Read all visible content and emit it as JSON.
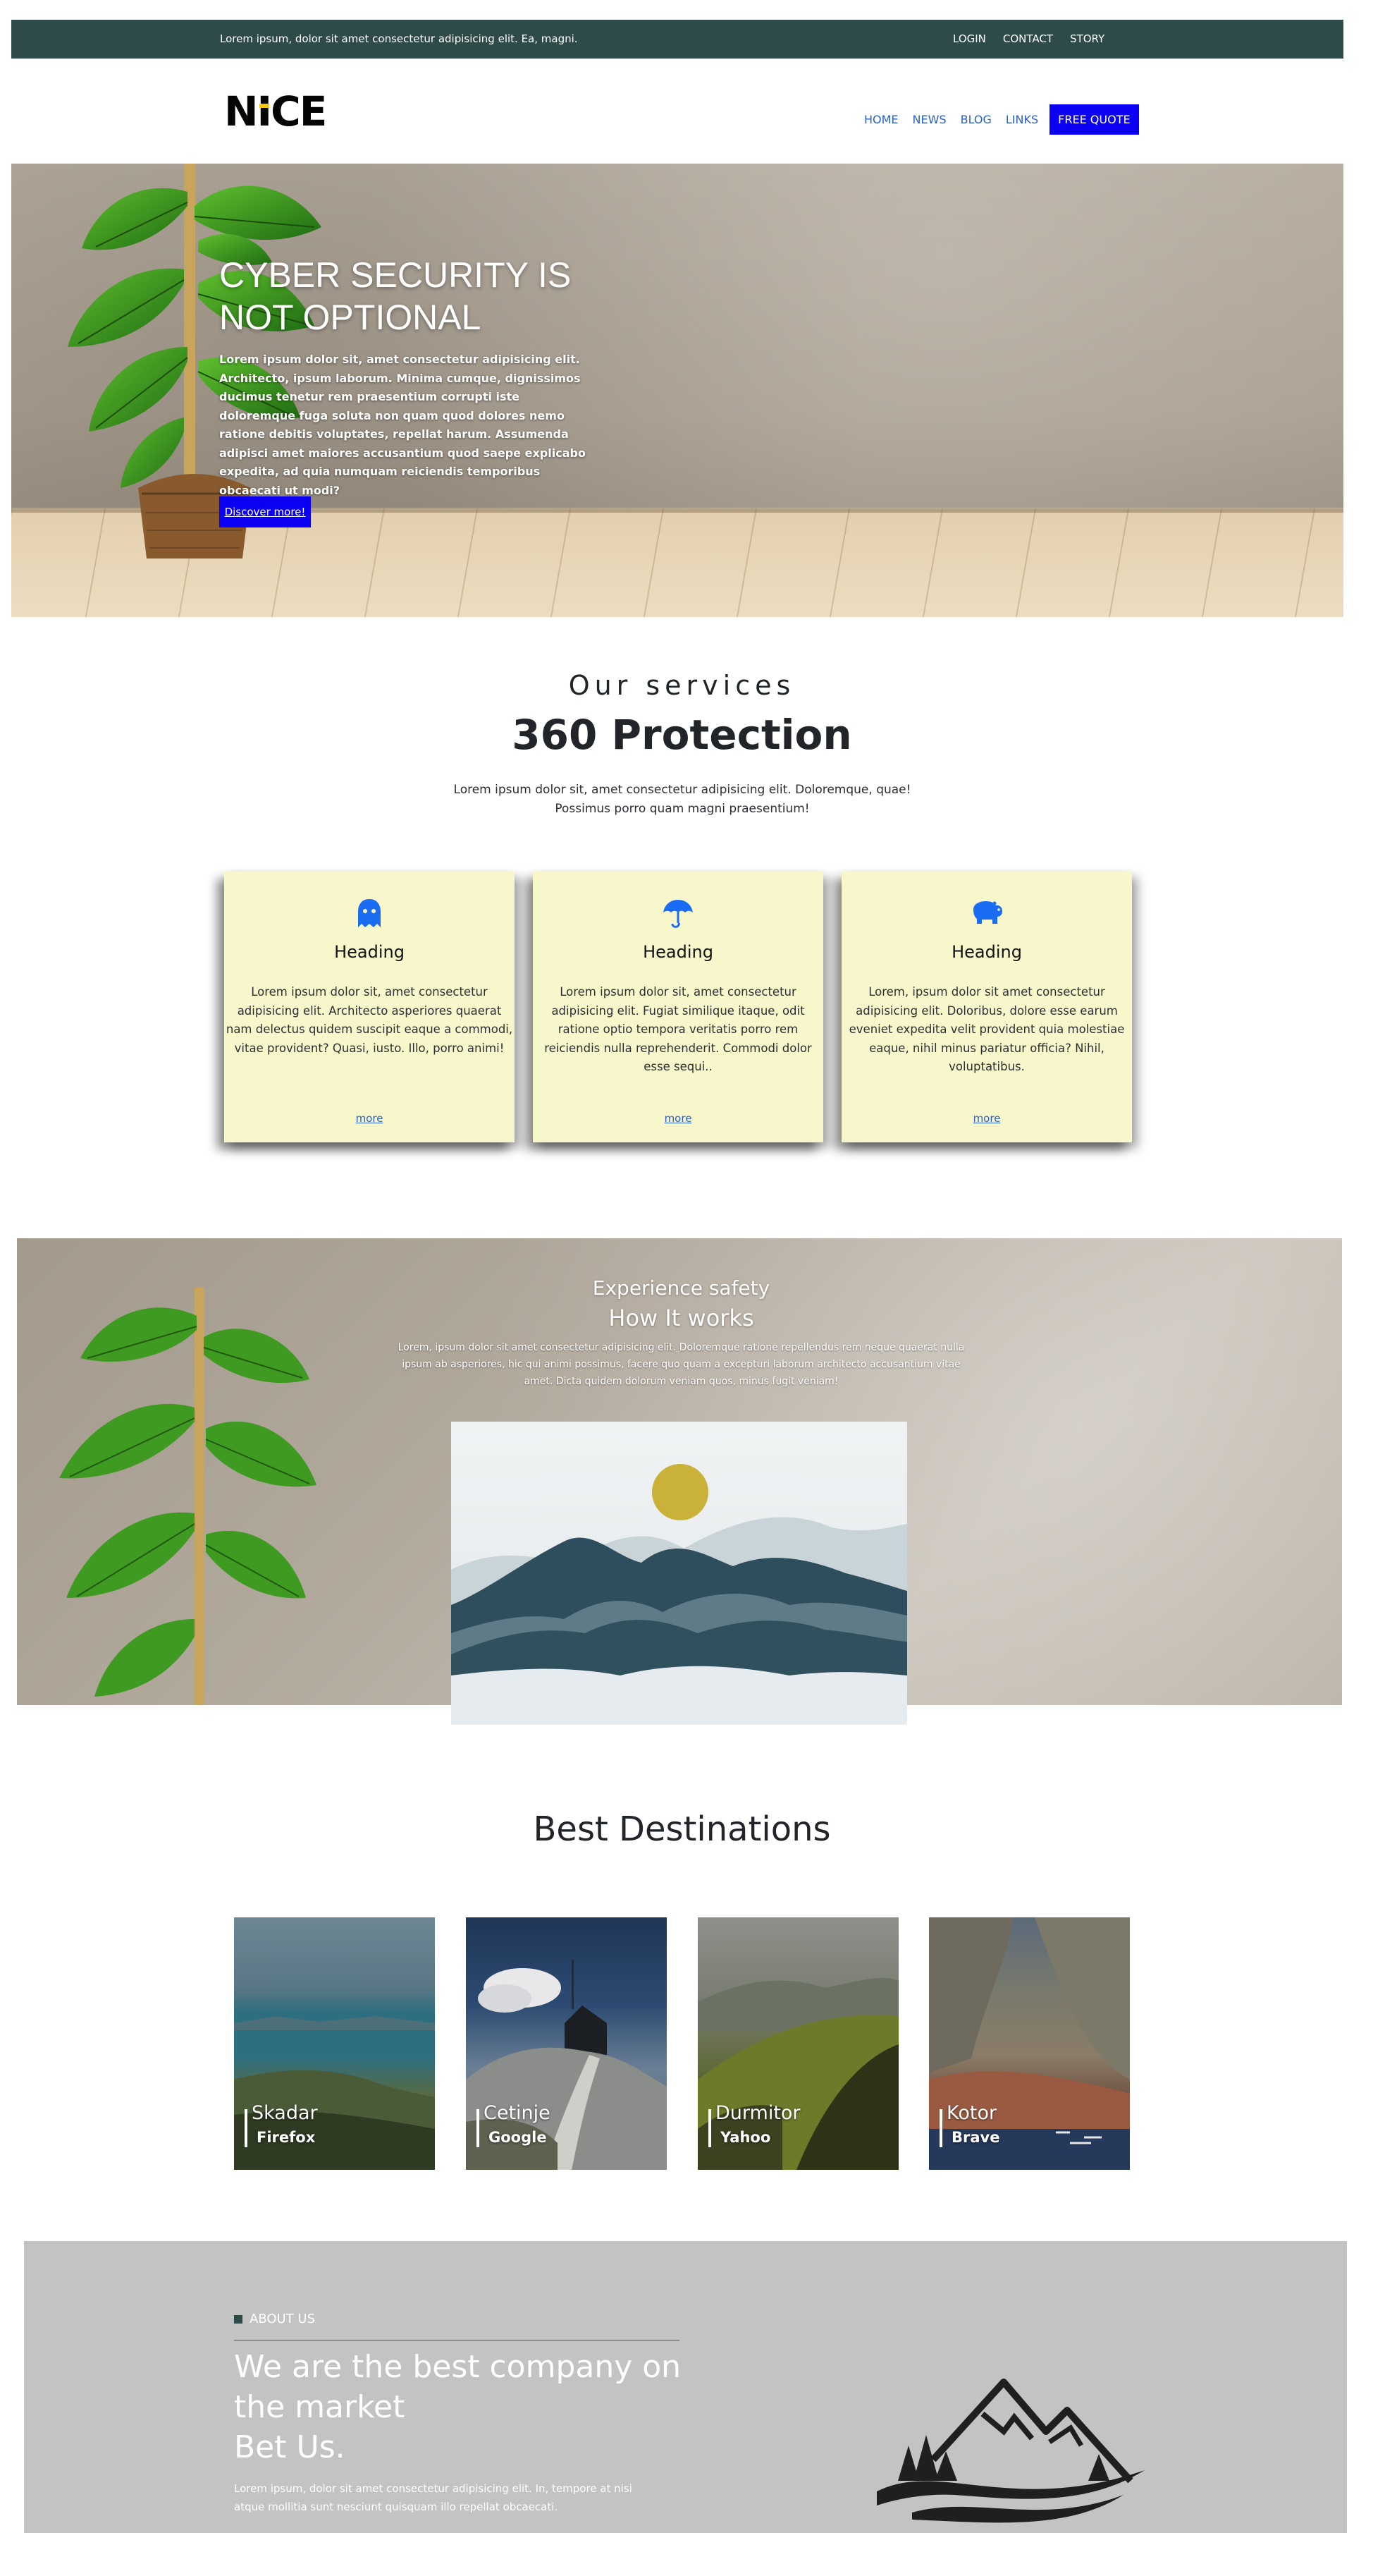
{
  "topbar": {
    "message": "Lorem ipsum, dolor sit amet consectetur adipisicing elit. Ea, magni.",
    "links": [
      "LOGIN",
      "CONTACT",
      "STORY"
    ]
  },
  "brand": {
    "logo_text_pre": "N",
    "logo_text_i": "I",
    "logo_text_post": "CE",
    "accent_color": "#f4c80e"
  },
  "nav": {
    "items": [
      "HOME",
      "NEWS",
      "BLOG",
      "LINKS"
    ],
    "cta": "FREE QUOTE",
    "cta_color": "#0b00f3"
  },
  "hero": {
    "title": "CYBER SECURITY IS NOT OPTIONAL",
    "text": "Lorem ipsum dolor sit, amet consectetur adipisicing elit. Architecto, ipsum laborum. Minima cumque, dignissimos ducimus tenetur rem praesentium corrupti iste doloremque fuga soluta non quam quod dolores nemo ratione debitis voluptates, repellat harum. Assumenda adipisci amet maiores accusantium quod saepe explicabo expedita, ad quia numquam reiciendis temporibus obcaecati ut modi?",
    "button": "Discover more!"
  },
  "services": {
    "kicker": "Our services",
    "title": "360 Protection",
    "intro": "Lorem ipsum dolor sit, amet consectetur adipisicing elit. Doloremque, quae! Possimus porro quam magni praesentium!",
    "cards": [
      {
        "icon": "ghost-icon",
        "heading": "Heading",
        "text": "Lorem ipsum dolor sit, amet consectetur adipisicing elit. Architecto asperiores quaerat nam delectus quidem suscipit eaque a commodi, vitae provident? Quasi, iusto. Illo, porro animi!",
        "link": "more"
      },
      {
        "icon": "umbrella-icon",
        "heading": "Heading",
        "text": "Lorem ipsum dolor sit, amet consectetur adipisicing elit. Fugiat similique itaque, odit ratione optio tempora veritatis porro rem reiciendis nulla reprehenderit. Commodi dolor esse sequi..",
        "link": "more"
      },
      {
        "icon": "hippo-icon",
        "heading": "Heading",
        "text": "Lorem, ipsum dolor sit amet consectetur adipisicing elit. Doloribus, dolore esse earum eveniet expedita velit provident quia molestiae eaque, nihil minus pariatur officia? Nihil, voluptatibus.",
        "link": "more"
      }
    ],
    "card_bg": "#f8f7cc",
    "icon_color": "#1a6cf2"
  },
  "how": {
    "kicker": "Experience safety",
    "title": "How It works",
    "text": "Lorem, ipsum dolor sit amet consectetur adipisicing elit. Doloremque ratione repellendus rem neque quaerat nulla ipsum ab asperiores, hic qui animi possimus, facere quo quam a excepturi laborum architecto accusantium vitae amet. Dicta quidem dolorum veniam quos, minus fugit veniam!"
  },
  "destinations": {
    "title": "Best Destinations",
    "items": [
      {
        "name": "Skadar",
        "sub": "Firefox"
      },
      {
        "name": "Cetinje",
        "sub": "Google"
      },
      {
        "name": "Durmitor",
        "sub": "Yahoo"
      },
      {
        "name": "Kotor",
        "sub": "Brave"
      }
    ]
  },
  "about": {
    "kicker": "ABOUT US",
    "title_line1": "We are the best company on",
    "title_line2": "the market",
    "title_line3": "Bet Us.",
    "text": "Lorem ipsum, dolor sit amet consectetur adipisicing elit. In, tempore at nisi atque mollitia sunt nesciunt quisquam illo repellat obcaecati."
  }
}
